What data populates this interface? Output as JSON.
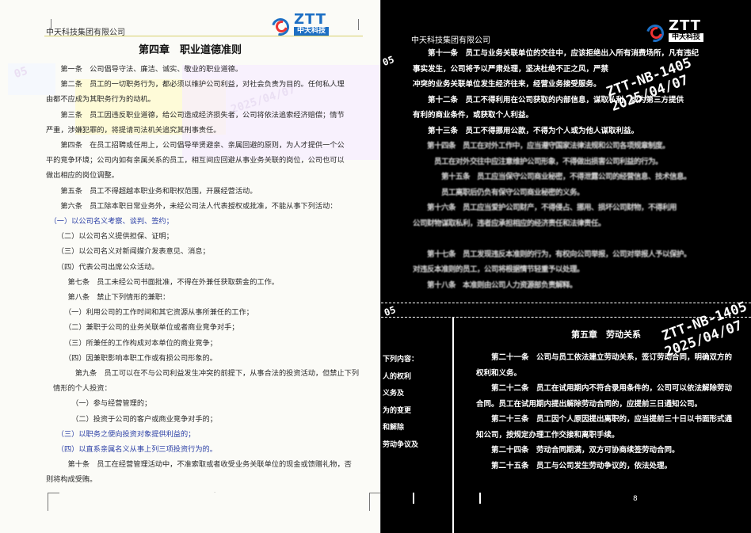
{
  "left_page": {
    "header": "中天科技集团有限公司",
    "logo": {
      "brand": "ZTT",
      "cn": "中天科技"
    },
    "title": "第四章　职业道德准则",
    "lines": [
      {
        "text": "　　第一条　公司倡导守法、廉洁、诚实、敬业的职业道德。",
        "style": "normal"
      },
      {
        "text": "　　第二条　员工的一切职务行为，都必须以维护公司利益，对社会负责为目的。任何私人理",
        "style": "normal"
      },
      {
        "text": "由都不应成为其职务行为的动机。",
        "style": "normal"
      },
      {
        "text": "　　第三条　员工因违反职业道德，给公司造成经济损失者，公司将依法追索经济赔偿；情节",
        "style": "normal"
      },
      {
        "text": "严重，涉嫌犯罪的，将提请司法机关追究其刑事责任。",
        "style": "normal"
      },
      {
        "text": "　　第四条　在员工招聘或任用上，公司倡导举贤避亲、亲属回避的原则，为人才提供一个公",
        "style": "normal"
      },
      {
        "text": "平的竞争环境；公司内如有亲属关系的员工，相互间应回避从事业务关联的岗位，公司也可以",
        "style": "normal"
      },
      {
        "text": "做出相应的岗位调整。",
        "style": "normal"
      },
      {
        "text": "　　第五条　员工不得超越本职业务和职权范围，开展经营活动。",
        "style": "normal"
      },
      {
        "text": "　　第六条　员工除本职日常业务外，未经公司法人代表授权或批准，不能从事下列活动：",
        "style": "normal"
      },
      {
        "text": "　（一）以公司名义考察、谈判、签约；",
        "style": "blue"
      },
      {
        "text": "　　（二）以公司名义提供担保、证明；",
        "style": "normal"
      },
      {
        "text": "　　（三）以公司名义对新闻媒介发表意见、消息；",
        "style": "normal"
      },
      {
        "text": "　　（四）代表公司出席公众活动。",
        "style": "normal"
      },
      {
        "text": "　　　第七条　员工未经公司书面批准，不得在外兼任获取薪金的工作。",
        "style": "normal"
      },
      {
        "text": "　　　第八条　禁止下列情形的兼职：",
        "style": "normal"
      },
      {
        "text": "　　　（一）利用公司的工作时间和其它资源从事所兼任的工作；",
        "style": "normal"
      },
      {
        "text": "　　　（二）兼职于公司的业务关联单位或者商业竞争对手；",
        "style": "normal"
      },
      {
        "text": "　　　（三）所兼任的工作构成对本单位的商业竞争；",
        "style": "normal"
      },
      {
        "text": "　　　（四）因兼职影响本职工作或有损公司形象的。",
        "style": "normal"
      },
      {
        "text": "　　　　第九条　员工可以在不与公司利益发生冲突的前提下，从事合法的投资活动，但禁止下列",
        "style": "normal"
      },
      {
        "text": "　情形的个人投资：",
        "style": "normal"
      },
      {
        "text": "　　　　（一）参与经营管理的；",
        "style": "normal"
      },
      {
        "text": "　　　　（二）投资于公司的客户或商业竞争对手的；",
        "style": "normal"
      },
      {
        "text": "　　（三）以职务之便向投资对象提供利益的；",
        "style": "blue"
      },
      {
        "text": "　　（四）以直系亲属名义从事上列三项投资行为的。",
        "style": "blue"
      },
      {
        "text": "　　　第十条　员工在经营管理活动中，不准索取或者收受业务关联单位的现金或馈赠礼物，否",
        "style": "normal"
      },
      {
        "text": "则将构成受贿。",
        "style": "normal"
      }
    ],
    "watermarks": [
      "2025/04/07",
      "05"
    ]
  },
  "right_page": {
    "header": "中天科技集团有限公司",
    "logo": {
      "brand": "ZTT",
      "cn": "中天科技"
    },
    "lines": [
      {
        "text": "　　第十一条　员工与业务关联单位的交往中，应该拒绝出入所有消费场所，凡有违纪",
        "style": "normal"
      },
      {
        "text": "事实发生，公司将予以严肃处理，坚决杜绝不正之风，严禁",
        "style": "normal"
      },
      {
        "text": "冲突的业务关联单位发生经济往来，经营业务接受服务。",
        "style": "normal"
      },
      {
        "text": "　　第十二条　员工不得利用在公司获取的内部信息，谋取私利，或为第三方提供",
        "style": "normal"
      },
      {
        "text": "有利的商业条件，或获取个人利益。",
        "style": "normal"
      },
      {
        "text": "　　第十三条　员工不得挪用公款，不得为个人或为他人谋取利益。",
        "style": "normal"
      },
      {
        "text": "　　第十四条　员工在对外工作中，应当遵守国家法律法规和公司各项规章制度。",
        "style": "blur"
      },
      {
        "text": "　　　员工在对外交往中应注意维护公司形象，不得做出损害公司利益的行为。",
        "style": "blur"
      },
      {
        "text": "　　　　第十五条　员工应当保守公司商业秘密，不得泄露公司的经营信息、技术信息。",
        "style": "blur"
      },
      {
        "text": "　　　　员工离职后仍负有保守公司商业秘密的义务。",
        "style": "blur"
      },
      {
        "text": "　　第十六条　员工应当爱护公司财产，不得侵占、挪用、损坏公司财物，不得利用",
        "style": "blur"
      },
      {
        "text": "公司财物谋取私利，违者应承担相应的经济责任和法律责任。",
        "style": "blur"
      },
      {
        "text": "　　　",
        "style": "blur"
      },
      {
        "text": "　　第十七条　员工发现违反本准则的行为，有权向公司举报，公司对举报人予以保护。",
        "style": "blur"
      },
      {
        "text": "对违反本准则的员工，公司将根据情节轻重予以处理。",
        "style": "blur"
      },
      {
        "text": "　　第十八条　本准则由公司人力资源部负责解释。",
        "style": "blur"
      }
    ],
    "watermarks": [
      "ZTT-NB-1405",
      "2025/04/07",
      "05"
    ],
    "sub_section": {
      "title": "第五章　劳动关系",
      "lines": [
        "　　第二十一条　公司与员工依法建立劳动关系，签订劳动合同，明确双方的",
        "权利和义务。",
        "　　第二十二条　员工在试用期内不符合录用条件的，公司可以依法解除劳动",
        "合同。员工在试用期内提出解除劳动合同的，应提前三日通知公司。",
        "　　第二十三条　员工因个人原因提出离职的，应当提前三十日以书面形式通",
        "知公司，按规定办理工作交接和离职手续。",
        "　　第二十四条　劳动合同期满，双方可协商续签劳动合同。",
        "　　第二十五条　员工与公司发生劳动争议的，依法处理。"
      ],
      "side_lines": [
        "下列内容：",
        "人的权利",
        "义务及",
        "为的变更",
        "和解除",
        "劳动争议及"
      ]
    },
    "page_number": "8"
  }
}
